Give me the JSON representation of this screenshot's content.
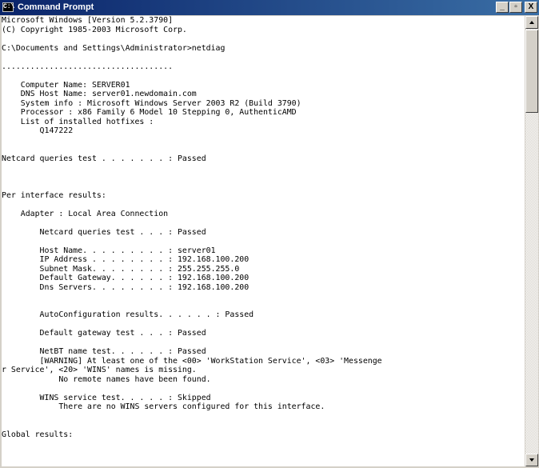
{
  "window": {
    "title": "Command Prompt",
    "icon_label": "C:\\",
    "buttons": {
      "minimize": "_",
      "maximize": "▫",
      "close": "X"
    }
  },
  "console": {
    "lines": [
      "Microsoft Windows [Version 5.2.3790]",
      "(C) Copyright 1985-2003 Microsoft Corp.",
      "",
      "C:\\Documents and Settings\\Administrator>netdiag",
      "",
      "....................................",
      "",
      "    Computer Name: SERVER01",
      "    DNS Host Name: server01.newdomain.com",
      "    System info : Microsoft Windows Server 2003 R2 (Build 3790)",
      "    Processor : x86 Family 6 Model 10 Stepping 0, AuthenticAMD",
      "    List of installed hotfixes :",
      "        Q147222",
      "",
      "",
      "Netcard queries test . . . . . . . : Passed",
      "",
      "",
      "",
      "Per interface results:",
      "",
      "    Adapter : Local Area Connection",
      "",
      "        Netcard queries test . . . : Passed",
      "",
      "        Host Name. . . . . . . . . : server01",
      "        IP Address . . . . . . . . : 192.168.100.200",
      "        Subnet Mask. . . . . . . . : 255.255.255.0",
      "        Default Gateway. . . . . . : 192.168.100.200",
      "        Dns Servers. . . . . . . . : 192.168.100.200",
      "",
      "",
      "        AutoConfiguration results. . . . . . : Passed",
      "",
      "        Default gateway test . . . : Passed",
      "",
      "        NetBT name test. . . . . . : Passed",
      "        [WARNING] At least one of the <00> 'WorkStation Service', <03> 'Messenge",
      "r Service', <20> 'WINS' names is missing.",
      "            No remote names have been found.",
      "",
      "        WINS service test. . . . . : Skipped",
      "            There are no WINS servers configured for this interface.",
      "",
      "",
      "Global results:"
    ]
  }
}
